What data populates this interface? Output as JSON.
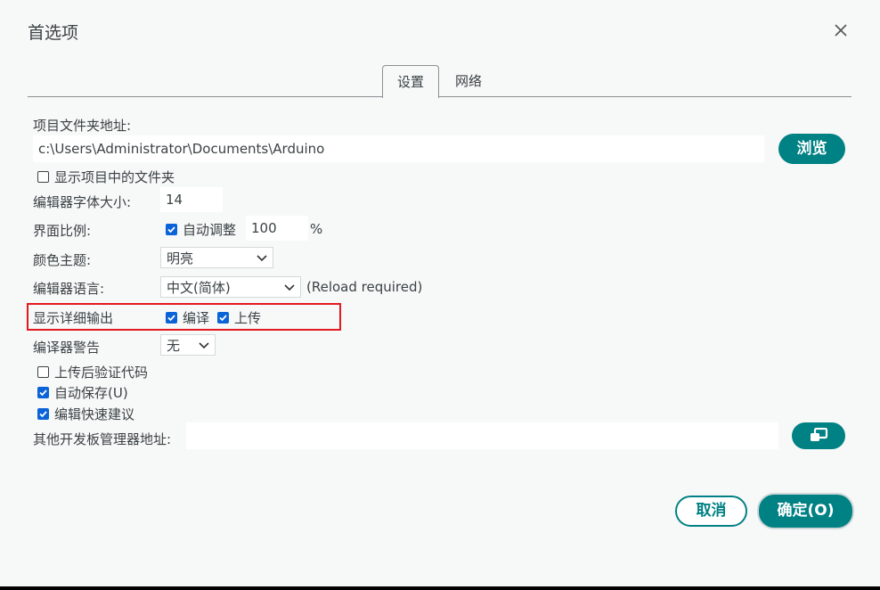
{
  "dialog": {
    "title": "首选项"
  },
  "tabs": [
    {
      "label": "设置",
      "active": true
    },
    {
      "label": "网络",
      "active": false
    }
  ],
  "settings": {
    "sketchbook_location_label": "项目文件夹地址:",
    "sketchbook_path": "c:\\Users\\Administrator\\Documents\\Arduino",
    "browse_label": "浏览",
    "show_files_in_folder_label": "显示项目中的文件夹",
    "show_files_in_folder_checked": false,
    "editor_font_size_label": "编辑器字体大小:",
    "editor_font_size_value": "14",
    "interface_scale_label": "界面比例:",
    "auto_adjust_label": "自动调整",
    "auto_adjust_checked": true,
    "interface_scale_value": "100",
    "percent_sign": "%",
    "theme_label": "颜色主题:",
    "theme_value": "明亮",
    "language_label": "编辑器语言:",
    "language_value": "中文(简体)",
    "reload_note": "(Reload required)",
    "verbose_output_label": "显示详细输出",
    "verbose_compile_label": "编译",
    "verbose_compile_checked": true,
    "verbose_upload_label": "上传",
    "verbose_upload_checked": true,
    "compiler_warnings_label": "编译器警告",
    "compiler_warnings_value": "无",
    "verify_after_upload_label": "上传后验证代码",
    "verify_after_upload_checked": false,
    "auto_save_label": "自动保存(U)",
    "auto_save_checked": true,
    "quick_suggestions_label": "编辑快速建议",
    "quick_suggestions_checked": true,
    "board_manager_urls_label": "其他开发板管理器地址:",
    "board_manager_urls_value": ""
  },
  "footer": {
    "cancel_label": "取消",
    "ok_label": "确定(O)"
  },
  "colors": {
    "accent": "#008184",
    "checkbox": "#0b63d8",
    "highlight": "#e3191f",
    "background": "#f7f8f8"
  },
  "icons": {
    "close": "close-icon",
    "expand": "open-window-icon",
    "chevron": "chevron-down-icon"
  }
}
